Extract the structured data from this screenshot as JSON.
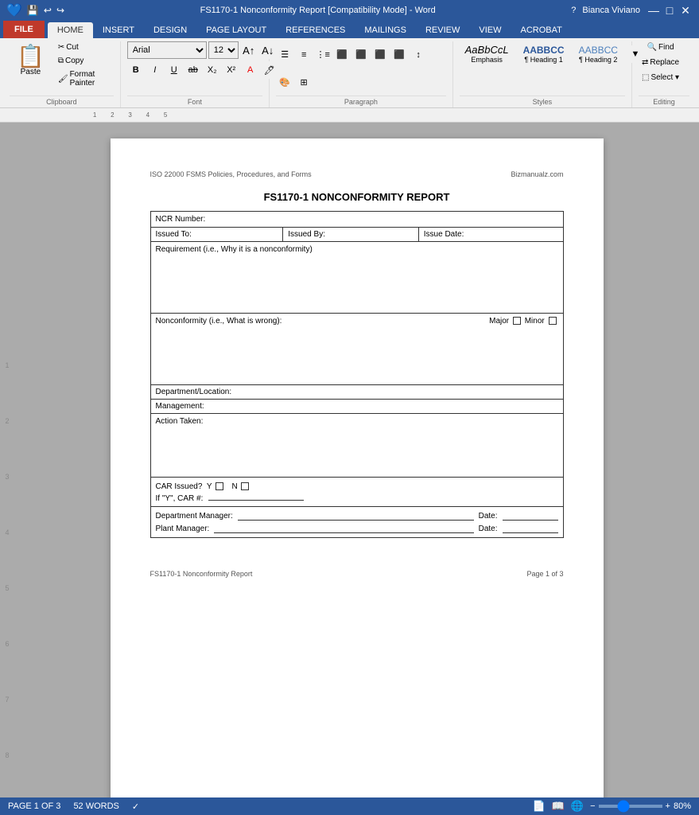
{
  "titlebar": {
    "title": "FS1170-1 Nonconformity Report [Compatibility Mode] - Word",
    "user": "Bianca Viviano",
    "controls": [
      "?",
      "—",
      "□",
      "✕"
    ]
  },
  "ribbon": {
    "tabs": [
      "FILE",
      "HOME",
      "INSERT",
      "DESIGN",
      "PAGE LAYOUT",
      "REFERENCES",
      "MAILINGS",
      "REVIEW",
      "VIEW",
      "ACROBAT"
    ],
    "active_tab": "HOME",
    "font": {
      "name": "Arial",
      "size": "12"
    },
    "clipboard_label": "Clipboard",
    "font_label": "Font",
    "paragraph_label": "Paragraph",
    "styles_label": "Styles",
    "editing_label": "Editing",
    "paste_label": "Paste",
    "cut_label": "Cut",
    "copy_label": "Copy",
    "format_painter_label": "Format Painter",
    "find_label": "Find",
    "replace_label": "Replace",
    "select_label": "Select ▾",
    "styles": [
      "Emphasis",
      "¶ Heading 1",
      "¶ Heading 2"
    ],
    "style_samples": [
      "AaBbCcL",
      "AABBCC",
      "AABBCC"
    ]
  },
  "document": {
    "header_left": "ISO 22000 FSMS Policies, Procedures, and Forms",
    "header_right": "Bizmanualz.com",
    "title": "FS1170-1 NONCONFORMITY REPORT",
    "form": {
      "ncr_label": "NCR Number:",
      "issued_to_label": "Issued To:",
      "issued_by_label": "Issued By:",
      "issue_date_label": "Issue Date:",
      "requirement_label": "Requirement (i.e., Why it is a nonconformity)",
      "nonconformity_label": "Nonconformity (i.e., What is wrong):",
      "major_label": "Major",
      "minor_label": "Minor",
      "dept_label": "Department/Location:",
      "management_label": "Management:",
      "action_label": "Action Taken:",
      "car_issued_label": "CAR Issued?",
      "car_y_label": "Y",
      "car_n_label": "N",
      "car_number_label": "If \"Y\", CAR #:",
      "dept_manager_label": "Department Manager:",
      "date1_label": "Date:",
      "plant_manager_label": "Plant Manager:",
      "date2_label": "Date:"
    }
  },
  "statusbar": {
    "page_info": "PAGE 1 OF 3",
    "words": "52 WORDS",
    "zoom": "80%",
    "footer_left": "FS1170-1 Nonconformity Report",
    "footer_right": "Page 1 of 3"
  }
}
